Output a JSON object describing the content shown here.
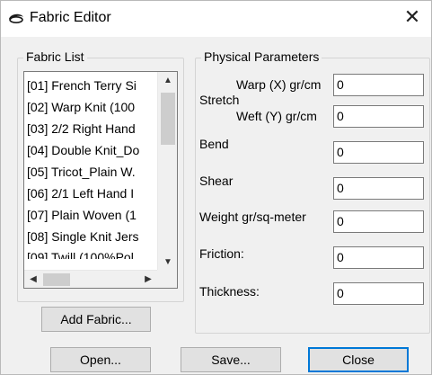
{
  "window": {
    "title": "Fabric Editor",
    "close_glyph": "✕",
    "app_icon": "fabric-app-icon"
  },
  "fabric_list": {
    "legend": "Fabric List",
    "items": [
      "[01] French Terry Si",
      "[02]  Warp Knit (100",
      "[03] 2/2 Right Hand",
      "[04] Double Knit_Do",
      "[05] Tricot_Plain W.",
      "[06] 2/1 Left Hand I",
      "[07] Plain Woven (1",
      "[08] Single Knit Jers",
      "[09] Twill (100%Pol"
    ],
    "add_button": "Add Fabric..."
  },
  "physical_parameters": {
    "legend": "Physical Parameters",
    "stretch_label": "Stretch",
    "warp_label": "Warp (X) gr/cm",
    "warp_value": "0",
    "weft_label": "Weft (Y) gr/cm",
    "weft_value": "0",
    "bend_label": "Bend",
    "bend_value": "0",
    "shear_label": "Shear",
    "shear_value": "0",
    "weight_label": "Weight  gr/sq-meter",
    "weight_value": "0",
    "friction_label": "Friction:",
    "friction_value": "0",
    "thickness_label": "Thickness:",
    "thickness_value": "0"
  },
  "footer": {
    "open_button": "Open...",
    "save_button": "Save...",
    "close_button": "Close"
  },
  "colors": {
    "dialog_bg": "#f0f0f0",
    "default_button_border": "#0078d7"
  }
}
